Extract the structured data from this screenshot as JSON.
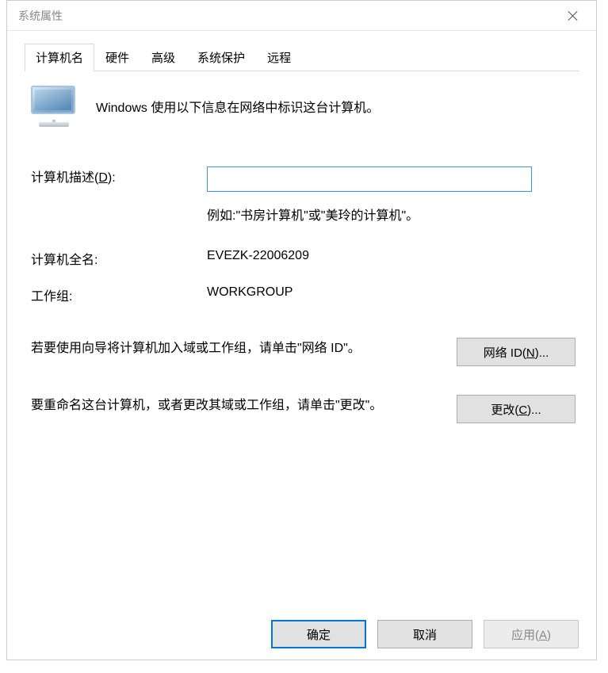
{
  "window": {
    "title": "系统属性"
  },
  "tabs": {
    "computer_name": "计算机名",
    "hardware": "硬件",
    "advanced": "高级",
    "system_protection": "系统保护",
    "remote": "远程"
  },
  "intro": "Windows 使用以下信息在网络中标识这台计算机。",
  "form": {
    "description_label": "计算机描述(D):",
    "description_value": "",
    "description_hint": "例如:\"书房计算机\"或\"美玲的计算机\"。",
    "fullname_label": "计算机全名:",
    "fullname_value": "EVEZK-22006209",
    "workgroup_label": "工作组:",
    "workgroup_value": "WORKGROUP"
  },
  "wizard": {
    "text": "若要使用向导将计算机加入域或工作组，请单击\"网络 ID\"。",
    "button": "网络 ID(N)..."
  },
  "rename": {
    "text": "要重命名这台计算机，或者更改其域或工作组，请单击\"更改\"。",
    "button": "更改(C)..."
  },
  "footer": {
    "ok": "确定",
    "cancel": "取消",
    "apply": "应用(A)"
  }
}
